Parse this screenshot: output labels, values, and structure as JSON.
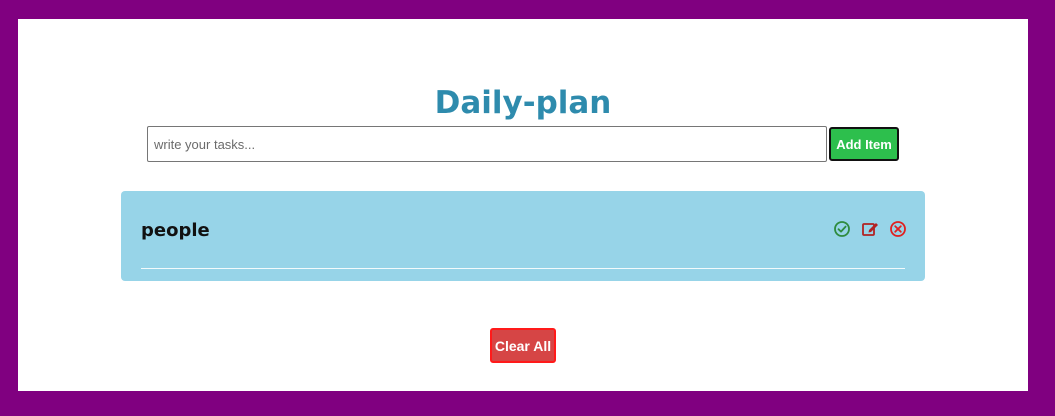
{
  "app": {
    "title": "Daily-plan"
  },
  "form": {
    "input_value": "",
    "input_placeholder": "write your tasks...",
    "add_label": "Add Item"
  },
  "list": {
    "items": [
      {
        "text": "people",
        "actions": [
          "check-circle-icon",
          "edit-icon",
          "close-circle-icon"
        ]
      }
    ]
  },
  "footer": {
    "clear_label": "Clear All"
  },
  "colors": {
    "frame": "#800080",
    "title": "#2e8bad",
    "add_button": "#2dbf4d",
    "list_background": "#97d4e8",
    "check_icon": "#2e8b3e",
    "edit_icon": "#b22222",
    "delete_icon": "#e02020",
    "clear_button": "#d64545"
  }
}
